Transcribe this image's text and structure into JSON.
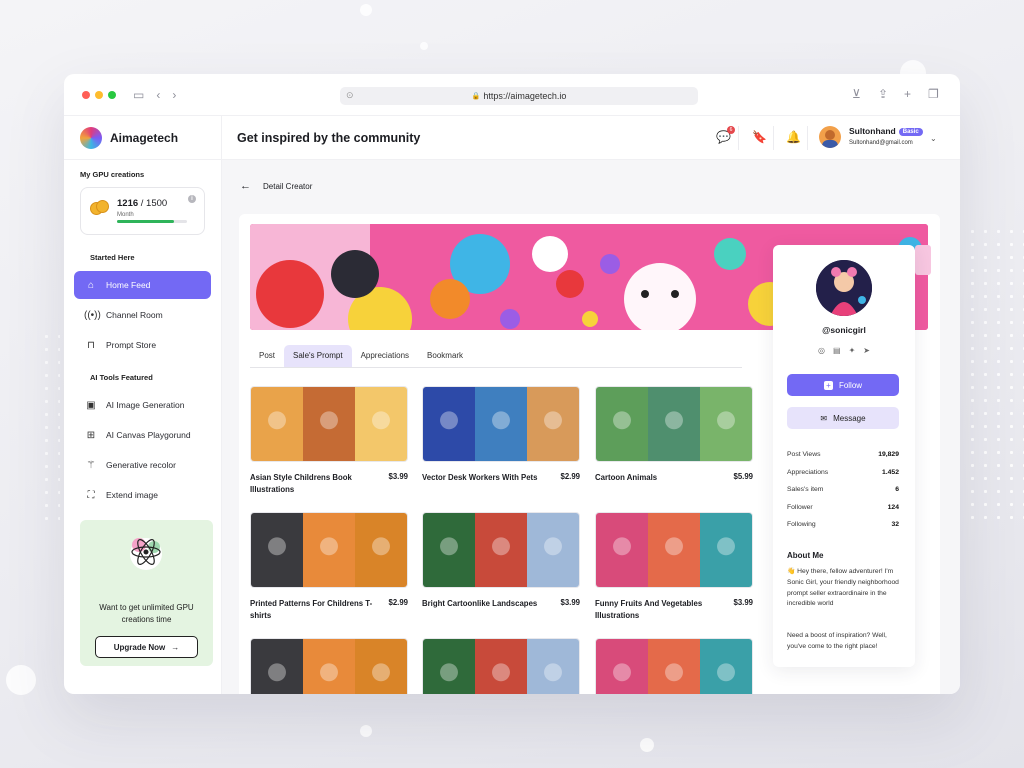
{
  "browser": {
    "url": "https://aimagetech.io"
  },
  "app": {
    "name": "Aimagetech"
  },
  "sidebar": {
    "gpu_title": "My GPU creations",
    "gpu_used": "1216",
    "gpu_total": "/ 1500",
    "gpu_period": "Month",
    "gpu_progress_fraction": 0.81,
    "started_title": "Started Here",
    "started_items": [
      {
        "label": "Home Feed",
        "icon": "home-icon",
        "active": true
      },
      {
        "label": "Channel Room",
        "icon": "broadcast-icon"
      },
      {
        "label": "Prompt Store",
        "icon": "bag-icon"
      }
    ],
    "tools_title": "AI Tools Featured",
    "tools_items": [
      {
        "label": "AI Image Generation",
        "icon": "image-icon"
      },
      {
        "label": "AI Canvas Playgorund",
        "icon": "gamepad-icon"
      },
      {
        "label": "Generative recolor",
        "icon": "magic-wand-icon"
      },
      {
        "label": "Extend image",
        "icon": "expand-icon"
      }
    ],
    "promo_text": "Want to get unlimited GPU creations time",
    "upgrade_label": "Upgrade Now",
    "upgrade_arrow": "→"
  },
  "header": {
    "title": "Get inspired by the community",
    "message_badge": "6",
    "user_name": "Sultonhand",
    "user_plan": "Basic",
    "user_email": "Sultonhand@gmail.com"
  },
  "breadcrumb": {
    "back_icon": "←",
    "label": "Detail Creator"
  },
  "tabs": [
    {
      "label": "Post"
    },
    {
      "label": "Sale's Prompt",
      "active": true
    },
    {
      "label": "Appreciations"
    },
    {
      "label": "Bookmark"
    }
  ],
  "products": [
    {
      "title": "Asian Style Childrens Book Illustrations",
      "price": "$3.99",
      "colors": [
        "#e9a34a",
        "#c56b34",
        "#f3c76a"
      ]
    },
    {
      "title": "Vector Desk Workers With Pets",
      "price": "$2.99",
      "colors": [
        "#2d4aa8",
        "#3f7fbf",
        "#d89a5a"
      ]
    },
    {
      "title": "Cartoon Animals",
      "price": "$5.99",
      "colors": [
        "#5d9e5a",
        "#4f8f6e",
        "#79b46a"
      ]
    },
    {
      "title": "Printed Patterns For Childrens T-shirts",
      "price": "$2.99",
      "colors": [
        "#3a3a3e",
        "#e88a3a",
        "#d98428"
      ]
    },
    {
      "title": "Bright Cartoonlike Landscapes",
      "price": "$3.99",
      "colors": [
        "#2f6a3a",
        "#c84a3a",
        "#9fb8d8"
      ]
    },
    {
      "title": "Funny Fruits And Vegetables Illustrations",
      "price": "$3.99",
      "colors": [
        "#d84b7a",
        "#e46a4a",
        "#3aa0a8"
      ]
    },
    {
      "title": "",
      "price": "",
      "colors": [
        "#3a3a3e",
        "#e88a3a",
        "#d98428"
      ]
    },
    {
      "title": "",
      "price": "",
      "colors": [
        "#2f6a3a",
        "#c84a3a",
        "#9fb8d8"
      ]
    },
    {
      "title": "",
      "price": "",
      "colors": [
        "#d84b7a",
        "#e46a4a",
        "#3aa0a8"
      ]
    }
  ],
  "profile": {
    "handle": "@sonicgirl",
    "socials": [
      "instagram-icon",
      "linkedin-icon",
      "twitter-icon",
      "telegram-icon"
    ],
    "follow_label": "Follow",
    "message_label": "Message",
    "stats": [
      {
        "label": "Post Views",
        "value": "19,829"
      },
      {
        "label": "Appreciations",
        "value": "1.452"
      },
      {
        "label": "Sales's item",
        "value": "6"
      },
      {
        "label": "Follower",
        "value": "124"
      },
      {
        "label": "Following",
        "value": "32"
      }
    ],
    "about_title": "About Me",
    "about_p1": "👋 Hey there, fellow adventurer! I'm Sonic Girl, your friendly neighborhood prompt seller extraordinaire in the incredible world",
    "about_p2": "Need a boost of inspiration? Well, you've come to the right place!"
  },
  "colors": {
    "accent": "#7369f4",
    "accent_soft": "#e7e3fb",
    "promo_bg": "#e4f4e1",
    "progress": "#2fb45a"
  }
}
